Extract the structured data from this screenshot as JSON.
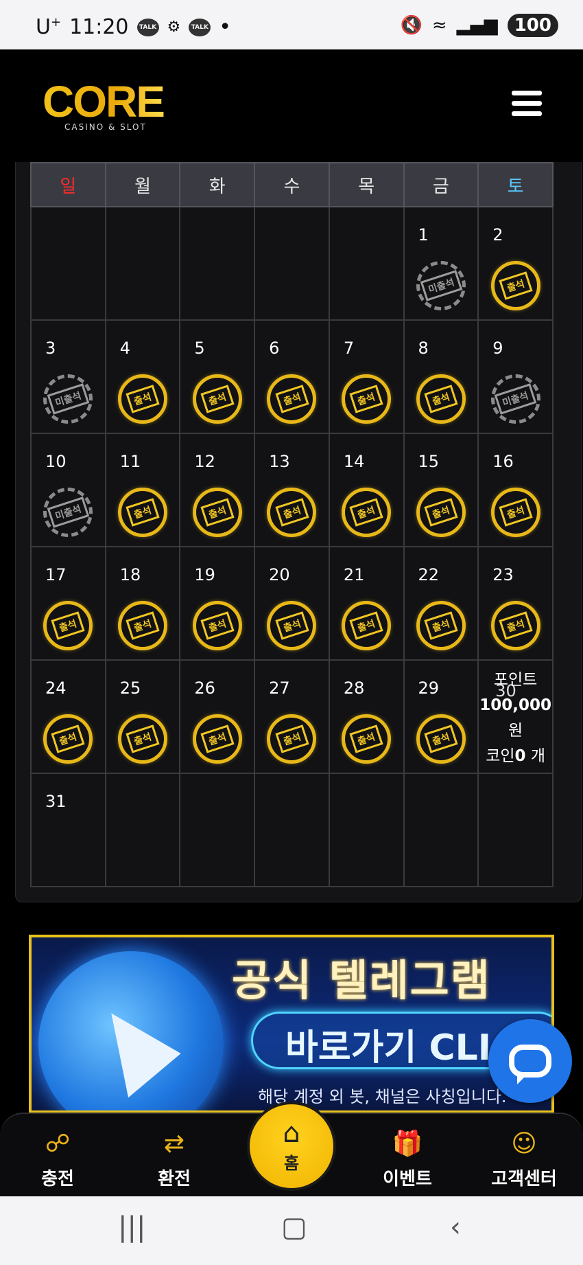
{
  "status_bar": {
    "carrier": "U",
    "carrier_sup": "+",
    "time": "11:20",
    "notif_talk": "TALK",
    "notif_dot": "•",
    "battery": "100"
  },
  "header": {
    "logo": "CORE",
    "logo_sub": "CASINO & SLOT"
  },
  "calendar": {
    "weekdays": [
      "일",
      "월",
      "화",
      "수",
      "목",
      "금",
      "토"
    ],
    "stamp_attended": "출석",
    "stamp_missed": "미출석",
    "reward": {
      "line1": "포인트",
      "amount": "100,000",
      "unit": "원",
      "coin_prefix": "코인",
      "coin_count": "0",
      "coin_suffix": " 개"
    }
  },
  "banner": {
    "title": "공식 텔레그램",
    "cta": "바로가기 CLICK",
    "note": "해당 계정 외 봇, 채널은 사칭입니다."
  },
  "bottom_nav": {
    "charge": "충전",
    "exchange": "환전",
    "home": "홈",
    "event": "이벤트",
    "support": "고객센터"
  }
}
